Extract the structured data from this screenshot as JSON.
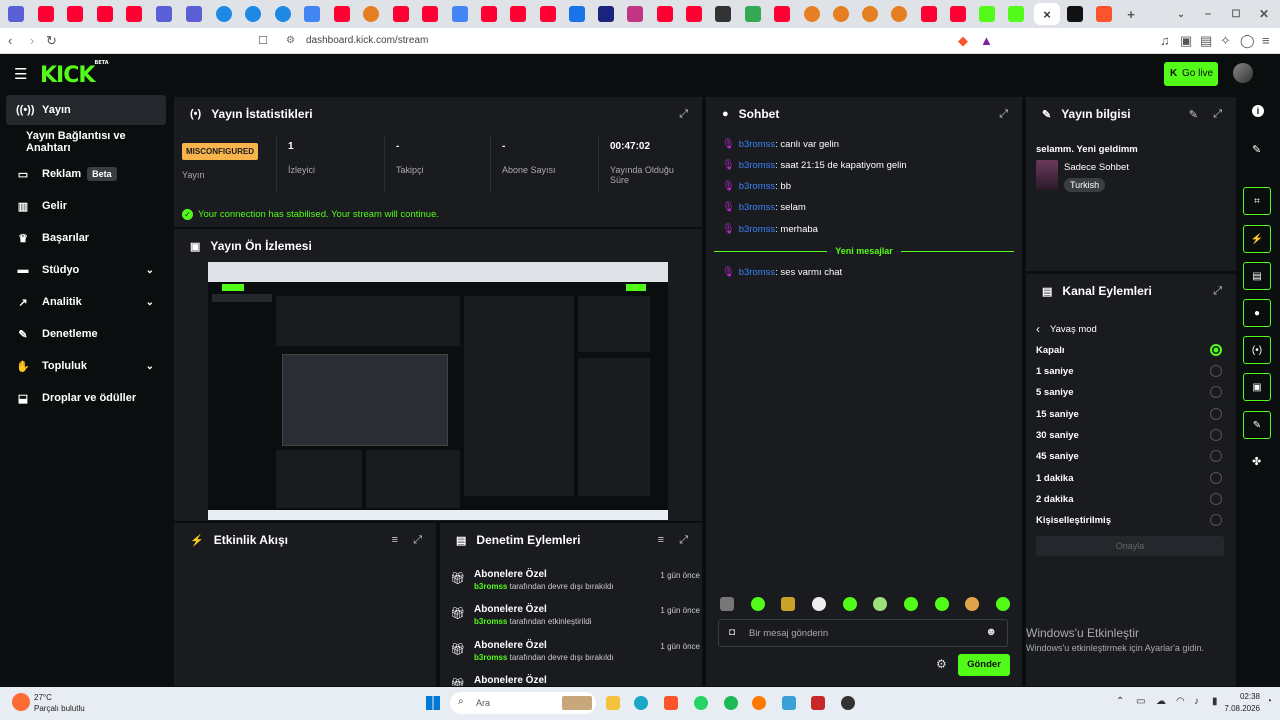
{
  "browser": {
    "url": "dashboard.kick.com/stream",
    "tab_close_icon": "×",
    "new_tab_icon": "+"
  },
  "header": {
    "logo": "KICK",
    "logo_badge": "BETA",
    "go_live_label": "Go live"
  },
  "sidebar": {
    "items": [
      {
        "label": "Yayın",
        "icon": "broadcast-icon"
      },
      {
        "label": "Yayın Bağlantısı ve Anahtarı",
        "icon": ""
      },
      {
        "label": "Reklam",
        "badge": "Beta",
        "icon": "monitor-icon"
      },
      {
        "label": "Gelir",
        "icon": "chart-icon"
      },
      {
        "label": "Başarılar",
        "icon": "trophy-icon"
      },
      {
        "label": "Stüdyo",
        "icon": "studio-icon"
      },
      {
        "label": "Analitik",
        "icon": "analytics-icon"
      },
      {
        "label": "Denetleme",
        "icon": "wrench-icon"
      },
      {
        "label": "Topluluk",
        "icon": "community-icon"
      },
      {
        "label": "Droplar ve ödüller",
        "icon": "drops-icon"
      }
    ]
  },
  "stats": {
    "title": "Yayın İstatistikleri",
    "status_badge": "MISCONFIGURED",
    "status_label": "Yayın",
    "viewers_value": "1",
    "viewers_label": "İzleyici",
    "followers_value": "-",
    "followers_label": "Takipçi",
    "subs_value": "-",
    "subs_label": "Abone Sayısı",
    "uptime_value": "00:47:02",
    "uptime_label": "Yayında Olduğu Süre",
    "connection_message": "Your connection has stabilised. Your stream will continue."
  },
  "preview": {
    "title": "Yayın Ön İzlemesi"
  },
  "activity": {
    "title": "Etkinlik Akışı"
  },
  "moderation": {
    "title": "Denetim Eylemleri",
    "items": [
      {
        "title": "Abonelere Özel",
        "user": "b3romss",
        "action": "tarafından devre dışı bırakıldı",
        "ago": "1 gün önce"
      },
      {
        "title": "Abonelere Özel",
        "user": "b3romss",
        "action": "tarafından etkinleştirildi",
        "ago": "1 gün önce"
      },
      {
        "title": "Abonelere Özel",
        "user": "b3romss",
        "action": "tarafından devre dışı bırakıldı",
        "ago": "1 gün önce"
      },
      {
        "title": "Abonelere Özel",
        "user": "",
        "action": "",
        "ago": ""
      }
    ]
  },
  "chat": {
    "title": "Sohbet",
    "messages": [
      {
        "user": "b3romss",
        "text": ": canlı var gelin"
      },
      {
        "user": "b3romss",
        "text": ": saat 21:15 de kapatiyom gelin"
      },
      {
        "user": "b3romss",
        "text": ": bb"
      },
      {
        "user": "b3romss",
        "text": ": selam"
      },
      {
        "user": "b3romss",
        "text": ": merhaba"
      }
    ],
    "new_messages_divider": "Yeni mesajlar",
    "new_messages": [
      {
        "user": "b3romss",
        "text": ": ses varmı chat"
      }
    ],
    "input_placeholder": "Bir mesaj gönderin",
    "send_label": "Gönder"
  },
  "stream_info": {
    "title": "Yayın bilgisi",
    "stream_title": "selamm. Yeni geldimm",
    "category": "Sadece Sohbet",
    "language_tag": "Turkish"
  },
  "channel_actions": {
    "title": "Kanal Eylemleri",
    "back_label": "Yavaş mod",
    "options": [
      {
        "label": "Kapalı",
        "selected": true
      },
      {
        "label": "1 saniye",
        "selected": false
      },
      {
        "label": "5 saniye",
        "selected": false
      },
      {
        "label": "15 saniye",
        "selected": false
      },
      {
        "label": "30 saniye",
        "selected": false
      },
      {
        "label": "45 saniye",
        "selected": false
      },
      {
        "label": "1 dakika",
        "selected": false
      },
      {
        "label": "2 dakika",
        "selected": false
      },
      {
        "label": "Kişiselleştirilmiş",
        "selected": false
      }
    ],
    "confirm_label": "Onayla"
  },
  "watermark": {
    "line1": "Windows'u Etkinleştir",
    "line2": "Windows'u etkinleştirmek için Ayarlar'a gidin."
  },
  "taskbar": {
    "weather_temp": "27°C",
    "weather_text": "Parçalı bulutlu",
    "search_placeholder": "Ara",
    "time": "02:38",
    "date": "7.08.2026"
  },
  "colors": {
    "accent": "#53fc18",
    "panel": "#191b1f",
    "bg": "#0b0e0f",
    "username": "#3b82f6",
    "warning": "#f8b44b"
  }
}
